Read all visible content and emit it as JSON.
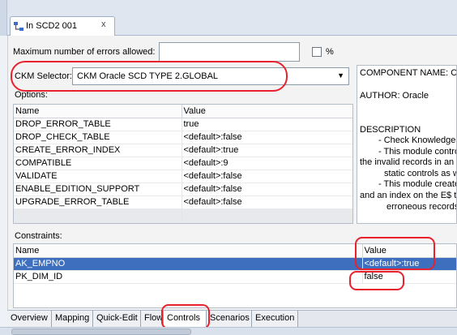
{
  "editor_tab": {
    "title": "In SCD2 001",
    "close": "x"
  },
  "form": {
    "max_errors_label": "Maximum number of errors allowed:",
    "max_errors_value": "",
    "percent_label": "%",
    "ckm_label": "CKM Selector:",
    "ckm_value": "CKM Oracle SCD TYPE 2.GLOBAL",
    "options_label": "Options:",
    "constraints_label": "Constraints:"
  },
  "options": {
    "columns": [
      "Name",
      "Value"
    ],
    "rows": [
      [
        "DROP_ERROR_TABLE",
        "true"
      ],
      [
        "DROP_CHECK_TABLE",
        "<default>:false"
      ],
      [
        "CREATE_ERROR_INDEX",
        "<default>:true"
      ],
      [
        "COMPATIBLE",
        "<default>:9"
      ],
      [
        "VALIDATE",
        "<default>:false"
      ],
      [
        "ENABLE_EDITION_SUPPORT",
        "<default>:false"
      ],
      [
        "UPGRADE_ERROR_TABLE",
        "<default>:false"
      ]
    ]
  },
  "description": {
    "lines": [
      "COMPONENT NAME: CKM",
      "AUTHOR: Oracle",
      "DESCRIPTION",
      "- Check Knowledge M",
      "- This module control",
      "the invalid records in an e",
      "static controls as w",
      "- This module creates",
      "and an index on the E$ ta",
      "erroneous records"
    ]
  },
  "constraints": {
    "columns": [
      "Name",
      "Value"
    ],
    "rows": [
      [
        "AK_EMPNO",
        "<default>:true"
      ],
      [
        "PK_DIM_ID",
        "false"
      ]
    ],
    "selected_index": 0
  },
  "bottom_tabs": [
    "Overview",
    "Mapping",
    "Quick-Edit",
    "Flow",
    "Controls",
    "Scenarios",
    "Execution"
  ],
  "active_tab": "Controls",
  "colors": {
    "selection": "#3e6fbf",
    "annotation": "#e8212d"
  }
}
